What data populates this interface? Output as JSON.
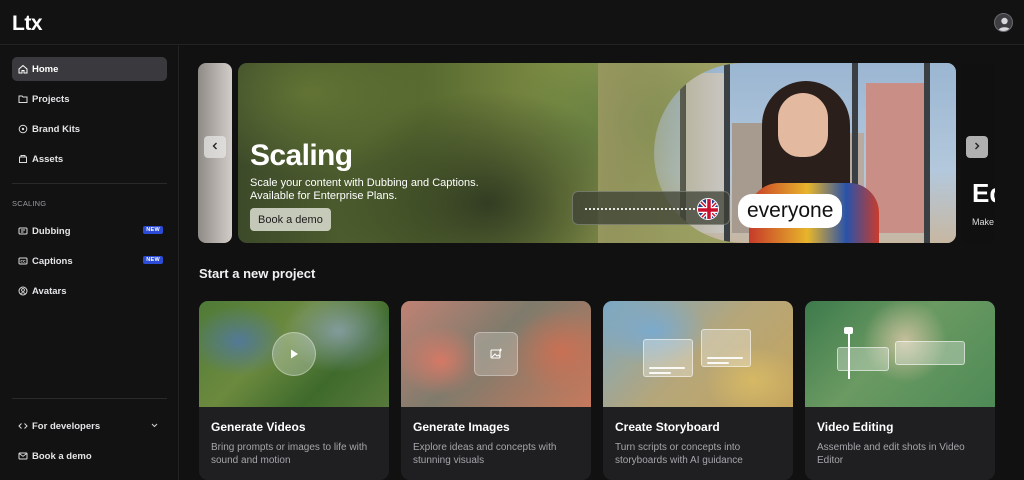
{
  "app": {
    "logo": "Ltx"
  },
  "sidebar": {
    "top_items": [
      {
        "label": "Home",
        "icon": "home-icon",
        "active": true
      },
      {
        "label": "Projects",
        "icon": "folder-icon"
      },
      {
        "label": "Brand Kits",
        "icon": "brand-kit-icon"
      },
      {
        "label": "Assets",
        "icon": "assets-icon"
      }
    ],
    "section_label": "SCALING",
    "scaling_items": [
      {
        "label": "Dubbing",
        "icon": "dubbing-icon",
        "badge": "NEW"
      },
      {
        "label": "Captions",
        "icon": "captions-icon",
        "badge": "NEW"
      },
      {
        "label": "Avatars",
        "icon": "avatar-icon"
      }
    ],
    "bottom_items": [
      {
        "label": "For developers",
        "icon": "code-icon"
      },
      {
        "label": "Book a demo",
        "icon": "mail-icon"
      }
    ]
  },
  "hero": {
    "title": "Scaling",
    "subtitle_line1": "Scale your content with Dubbing and Captions.",
    "subtitle_line2": "Available for Enterprise Plans.",
    "button": "Book a demo",
    "caption_word": "everyone",
    "next_slide_title": "Ed",
    "next_slide_sub": "Make"
  },
  "projects": {
    "title": "Start a new project",
    "cards": [
      {
        "title": "Generate Videos",
        "desc": "Bring prompts or images to life with sound and motion"
      },
      {
        "title": "Generate Images",
        "desc": "Explore ideas and concepts with stunning visuals"
      },
      {
        "title": "Create Storyboard",
        "desc": "Turn scripts or concepts into storyboards with AI guidance"
      },
      {
        "title": "Video Editing",
        "desc": "Assemble and edit shots in Video Editor"
      }
    ]
  },
  "colors": {
    "badge": "#2c4bd6",
    "background": "#111112",
    "active_nav": "#3a3a3e"
  }
}
